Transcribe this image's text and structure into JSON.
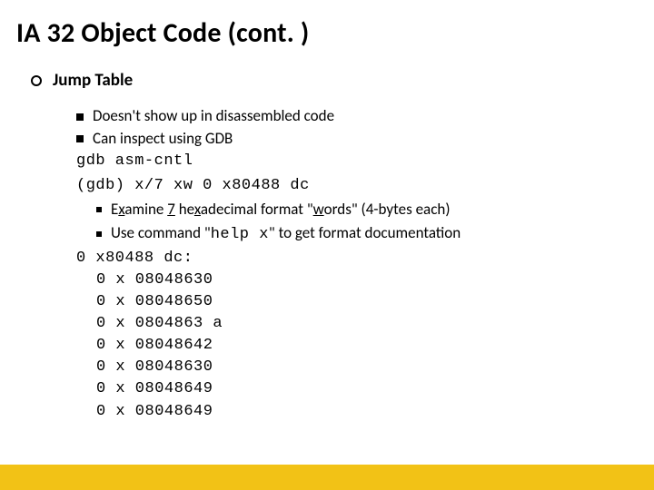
{
  "title": "IA 32 Object Code (cont. )",
  "l1": {
    "heading": "Jump Table"
  },
  "l2": {
    "items": [
      "Doesn't show up in disassembled code",
      "Can inspect using GDB"
    ]
  },
  "code": {
    "line1": " gdb asm-cntl",
    "line2": "(gdb) x/7 xw 0 x80488 dc"
  },
  "l3": {
    "a": [
      "E",
      "x",
      "amine ",
      "7",
      " he",
      "x",
      "adecimal format \"",
      "w",
      "ords\" (4-bytes each)"
    ],
    "b": [
      "Use command \"",
      "help x",
      "\" to get format documentation"
    ]
  },
  "addr": {
    "head": "0 x80488 dc:",
    "items": [
      "0 x 08048630",
      "0 x 08048650",
      "0 x 0804863 a",
      "0 x 08048642",
      "0 x 08048630",
      "0 x 08048649",
      "0 x 08048649"
    ]
  },
  "colors": {
    "accent": "#f2c216"
  }
}
